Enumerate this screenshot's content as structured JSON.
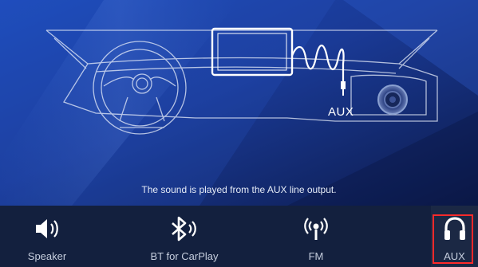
{
  "hero": {
    "aux_label": "AUX",
    "caption": "The sound is played from the AUX line output."
  },
  "nav": {
    "items": [
      {
        "label": "Speaker",
        "icon": "speaker-icon"
      },
      {
        "label": "BT for CarPlay",
        "icon": "bluetooth-icon"
      },
      {
        "label": "FM",
        "icon": "fm-radio-icon"
      },
      {
        "label": "AUX",
        "icon": "headphones-icon",
        "selected": true
      }
    ]
  },
  "colors": {
    "background": "#0d1c4a",
    "bottom_bar": "#13203e",
    "selected_outline": "#ff2a2a",
    "line_art": "#e8eefa"
  }
}
